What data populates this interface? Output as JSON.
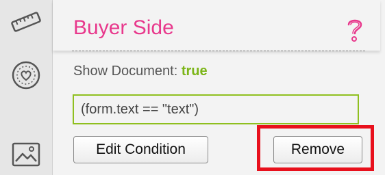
{
  "sidebar": {
    "icons": [
      "ruler-icon",
      "heart-badge-icon",
      "image-icon"
    ]
  },
  "header": {
    "title": "Buyer Side",
    "help_icon": "question-mark-icon"
  },
  "show_document": {
    "label": "Show Document:",
    "value": "true"
  },
  "condition": {
    "value": "(form.text == \"text\")"
  },
  "buttons": {
    "edit_condition": "Edit Condition",
    "remove": "Remove"
  },
  "colors": {
    "title": "#e8388c",
    "value_true": "#7cb518",
    "input_border": "#8fbf1f",
    "highlight": "#e8101c"
  }
}
